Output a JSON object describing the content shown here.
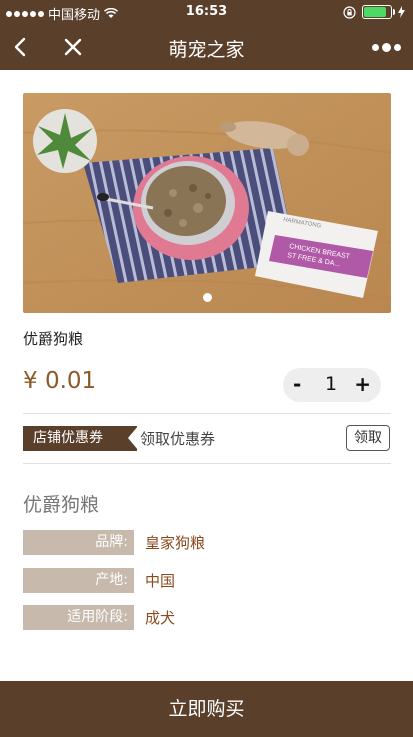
{
  "status_bar": {
    "carrier": "中国移动",
    "time": "16:53",
    "battery_level": 0.9
  },
  "nav": {
    "title": "萌宠之家"
  },
  "product": {
    "name": "优爵狗粮",
    "price": "¥ 0.01",
    "quantity": "1",
    "minus_label": "-",
    "plus_label": "+",
    "image_package_text": {
      "brand": "HARMATONG",
      "line1": "CHICKEN BREAST",
      "line2": "ST FREE & DA..."
    },
    "carousel": {
      "count": 1,
      "active": 0
    }
  },
  "coupon": {
    "tag": "店铺优惠券",
    "text": "领取优惠券",
    "button": "领取"
  },
  "details": {
    "title": "优爵狗粮",
    "attributes": [
      {
        "label": "品牌:",
        "value": "皇家狗粮"
      },
      {
        "label": "产地:",
        "value": "中国"
      },
      {
        "label": "适用阶段:",
        "value": "成犬"
      }
    ]
  },
  "buy_button": "立即购买",
  "colors": {
    "brand": "#5a3f2b",
    "price": "#8b5a2b",
    "attr_label_bg": "#c7b9ac",
    "attr_value": "#8b4a1e"
  },
  "icons": [
    "back-arrow-icon",
    "close-icon",
    "more-icon",
    "wifi-icon",
    "lock-rotation-icon",
    "battery-icon",
    "charging-icon"
  ]
}
